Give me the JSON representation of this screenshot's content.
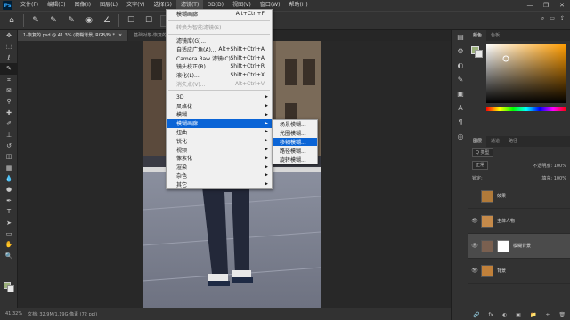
{
  "menubar": {
    "logo": "Ps",
    "items": [
      "文件(F)",
      "编辑(E)",
      "图像(I)",
      "图层(L)",
      "文字(Y)",
      "选择(S)",
      "滤镜(T)",
      "3D(D)",
      "视图(V)",
      "窗口(W)",
      "帮助(H)"
    ],
    "active_index": 6,
    "window_controls": [
      "—",
      "❐",
      "✕"
    ]
  },
  "options": {
    "choose_button": "选择"
  },
  "tabs": [
    {
      "label": "1-恢复的.psd @ 41.3% (模糊背景, RGB/8) *",
      "close": "×"
    },
    {
      "label": "基础对象-恢复的-1...",
      "close": "×"
    }
  ],
  "status": {
    "zoom": "41.32%",
    "doc": "文档: 32.9M/1.19G 像素 (72 ppi)"
  },
  "filter_menu": {
    "items": [
      {
        "label": "模糊画廊",
        "shortcut": "Alt+Ctrl+F",
        "type": "item"
      },
      {
        "type": "sep"
      },
      {
        "label": "转换为智能滤镜(S)",
        "shortcut": "",
        "type": "disabled"
      },
      {
        "type": "sep"
      },
      {
        "label": "滤镜库(G)...",
        "shortcut": "",
        "type": "item"
      },
      {
        "label": "自适应广角(A)...",
        "shortcut": "Alt+Shift+Ctrl+A",
        "type": "item"
      },
      {
        "label": "Camera Raw 滤镜(C)...",
        "shortcut": "Shift+Ctrl+A",
        "type": "item"
      },
      {
        "label": "镜头校正(R)...",
        "shortcut": "Shift+Ctrl+R",
        "type": "item"
      },
      {
        "label": "液化(L)...",
        "shortcut": "Shift+Ctrl+X",
        "type": "item"
      },
      {
        "label": "消失点(V)...",
        "shortcut": "Alt+Ctrl+V",
        "type": "disabled"
      },
      {
        "type": "sep"
      },
      {
        "label": "3D",
        "shortcut": "",
        "type": "sub"
      },
      {
        "label": "风格化",
        "shortcut": "",
        "type": "sub"
      },
      {
        "label": "模糊",
        "shortcut": "",
        "type": "sub"
      },
      {
        "label": "模糊画廊",
        "shortcut": "",
        "type": "sub-hl"
      },
      {
        "label": "扭曲",
        "shortcut": "",
        "type": "sub"
      },
      {
        "label": "锐化",
        "shortcut": "",
        "type": "sub"
      },
      {
        "label": "视频",
        "shortcut": "",
        "type": "sub"
      },
      {
        "label": "像素化",
        "shortcut": "",
        "type": "sub"
      },
      {
        "label": "渲染",
        "shortcut": "",
        "type": "sub"
      },
      {
        "label": "杂色",
        "shortcut": "",
        "type": "sub"
      },
      {
        "label": "其它",
        "shortcut": "",
        "type": "sub"
      }
    ]
  },
  "blur_gallery_submenu": {
    "items": [
      "场景模糊...",
      "光圈模糊...",
      "移轴模糊...",
      "路径模糊...",
      "旋转模糊..."
    ],
    "highlight_index": 2
  },
  "right_panel": {
    "color_tabs": [
      "颜色",
      "色板"
    ],
    "layer_tabs": [
      "图层",
      "通道",
      "路径"
    ],
    "filter_kind": "Q 类型",
    "blend_mode": "正常",
    "opacity_label": "不透明度: 100%",
    "fill_label": "填充: 100%",
    "lock_label": "锁定:",
    "layers": [
      {
        "name": "效果",
        "selected": false,
        "visible": false,
        "color": "#b07a3a"
      },
      {
        "name": "主体人物",
        "selected": false,
        "visible": true,
        "color": "#c58a4a"
      },
      {
        "name": "模糊背景",
        "selected": true,
        "visible": true,
        "color": "#7a6050"
      },
      {
        "name": "背景",
        "selected": false,
        "visible": true,
        "color": "#c0803a"
      }
    ],
    "bottom_icons": [
      "fx",
      "◐",
      "▣",
      "📁",
      "+",
      "🗑"
    ]
  },
  "colors": {
    "foreground": "#9bb07a",
    "background": "#e8e8e8",
    "menu_highlight": "#0a64d6"
  }
}
